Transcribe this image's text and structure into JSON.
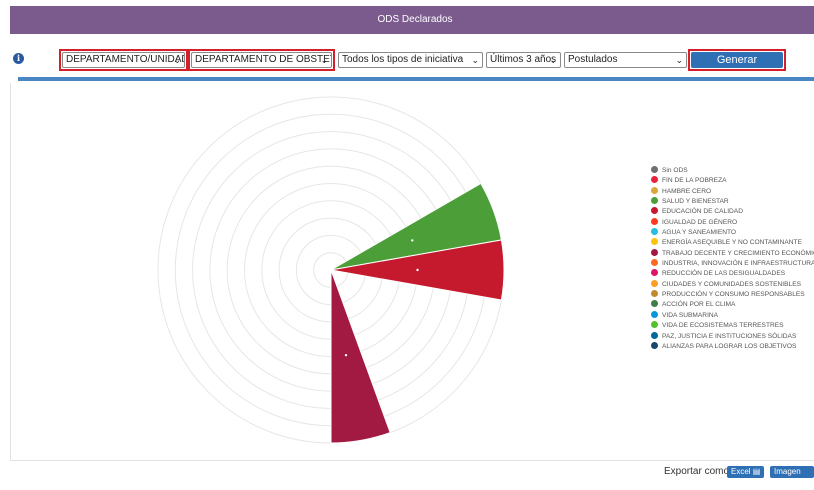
{
  "header": {
    "title": "ODS Declarados"
  },
  "toolbar": {
    "filter_level": "DEPARTAMENTO/UNIDAD",
    "filter_department": "DEPARTAMENTO DE OBSTETRICI",
    "filter_type": "Todos los tipos de iniciativa",
    "filter_period": "Últimos 3 años",
    "filter_status": "Postulados",
    "generate_label": "Generar"
  },
  "chart_data": {
    "type": "polar-area",
    "categories": [
      "Sin ODS",
      "FIN DE LA POBREZA",
      "HAMBRE CERO",
      "SALUD Y BIENESTAR",
      "EDUCACIÓN DE CALIDAD",
      "IGUALDAD DE GÉNERO",
      "AGUA Y SANEAMIENTO",
      "ENERGÍA ASEQUIBLE Y NO CONTAMINANTE",
      "TRABAJO DECENTE Y CRECIMIENTO ECONÓMICO",
      "INDUSTRIA, INNOVACIÓN E INFRAESTRUCTURA",
      "REDUCCIÓN DE LAS DESIGUALDADES",
      "CIUDADES Y COMUNIDADES SOSTENIBLES",
      "PRODUCCIÓN Y CONSUMO RESPONSABLES",
      "ACCIÓN POR EL CLIMA",
      "VIDA SUBMARINA",
      "VIDA DE ECOSISTEMAS TERRESTRES",
      "PAZ, JUSTICIA E INSTITUCIONES SÓLIDAS",
      "ALIANZAS PARA LOGRAR LOS OBJETIVOS"
    ],
    "colors": [
      "#707070",
      "#e5243b",
      "#dda63a",
      "#4c9f38",
      "#c5192d",
      "#ff3a21",
      "#26bde2",
      "#fcc30b",
      "#a21942",
      "#fd6925",
      "#dd1367",
      "#fd9d24",
      "#bf8b2e",
      "#3f7e44",
      "#0a97d9",
      "#56c02b",
      "#00689d",
      "#19486a"
    ],
    "values": [
      0,
      0,
      0,
      1,
      1,
      0,
      0,
      0,
      1,
      0,
      0,
      0,
      0,
      0,
      0,
      0,
      0,
      0
    ],
    "grid": true,
    "legend": "right"
  },
  "legend_label": "Sin ODS",
  "export": {
    "label": "Exportar como",
    "excel": "Excel",
    "image": "Imagen"
  }
}
